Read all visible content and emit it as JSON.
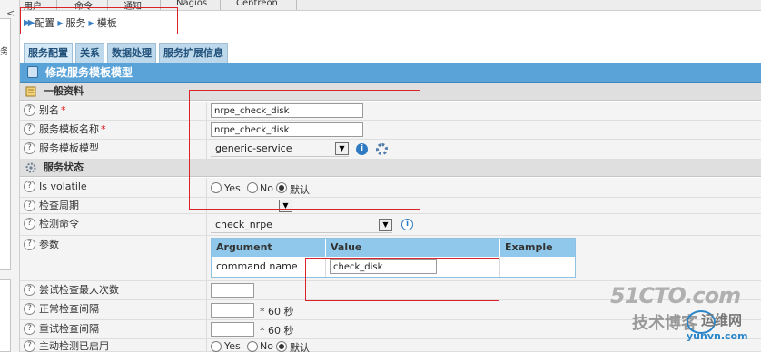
{
  "top_menu": {
    "items": [
      "用户",
      "命令",
      "通知",
      "Nagios",
      "Centreon"
    ]
  },
  "left_panel": {
    "collapse_arrow": "<",
    "cut_text": "务"
  },
  "breadcrumb": {
    "items": [
      "配置",
      "服务",
      "模板"
    ]
  },
  "tabs": [
    "服务配置",
    "关系",
    "数据处理",
    "服务扩展信息"
  ],
  "form": {
    "title": "修改服务模板模型",
    "sections": {
      "general": "一般资料",
      "status": "服务状态"
    },
    "fields": {
      "alias_label": "别名",
      "alias_value": "nrpe_check_disk",
      "template_name_label": "服务模板名称",
      "template_name_value": "nrpe_check_disk",
      "template_model_label": "服务模板模型",
      "template_model_value": "generic-service",
      "is_volatile_label": "Is volatile",
      "volatile_options": [
        "Yes",
        "No",
        "默认"
      ],
      "check_period_label": "检查周期",
      "check_period_value": "",
      "check_command_label": "检测命令",
      "check_command_value": "check_nrpe",
      "args_label": "参数",
      "max_attempts_label": "尝试检查最大次数",
      "max_attempts_value": "",
      "normal_interval_label": "正常检查间隔",
      "normal_interval_value": "",
      "normal_interval_unit": "* 60 秒",
      "retry_interval_label": "重试检查间隔",
      "retry_interval_value": "",
      "retry_interval_unit": "* 60 秒",
      "active_checks_label": "主动检测已启用",
      "active_options": [
        "Yes",
        "No",
        "默认"
      ]
    },
    "arg_table": {
      "headers": [
        "Argument",
        "Value",
        "Example"
      ],
      "rows": [
        {
          "argument": "command name",
          "value": "check_disk",
          "example": ""
        }
      ]
    },
    "required_mark": "*"
  },
  "watermark": {
    "line1": "51CTO.com",
    "line2": "技术博客",
    "line3": "运维网",
    "line4": "yunvn.com"
  },
  "colors": {
    "accent_blue": "#5aa3d8",
    "tab_bg": "#bcd8ea",
    "table_header": "#8fc8ea",
    "annotation_red": "#d9222a",
    "section_grey": "#dfdfdf"
  }
}
